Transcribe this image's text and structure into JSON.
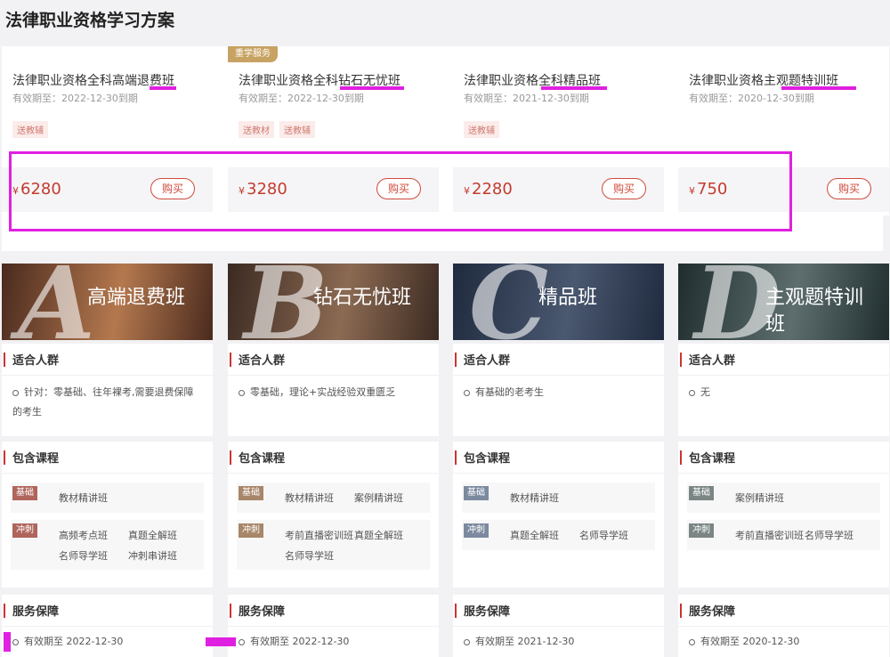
{
  "page_title": "法律职业资格学习方案",
  "plans": [
    {
      "badge": "",
      "name": "法律职业资格全科高端退费班",
      "expiry": "有效期至：2022-12-30到期",
      "tags": [
        "送教辅"
      ],
      "currency": "¥",
      "price": "6280",
      "buy": "购买"
    },
    {
      "badge": "重学服务",
      "name": "法律职业资格全科钻石无忧班",
      "expiry": "有效期至：2022-12-30到期",
      "tags": [
        "送教材",
        "送教辅"
      ],
      "currency": "¥",
      "price": "3280",
      "buy": "购买"
    },
    {
      "badge": "",
      "name": "法律职业资格全科精品班",
      "expiry": "有效期至：2021-12-30到期",
      "tags": [
        "送教辅"
      ],
      "currency": "¥",
      "price": "2280",
      "buy": "购买"
    },
    {
      "badge": "",
      "name": "法律职业资格主观题特训班",
      "expiry": "有效期至：2020-12-30到期",
      "tags": [],
      "currency": "¥",
      "price": "750",
      "buy": "购买"
    }
  ],
  "tiers": [
    {
      "letter": "A",
      "title": "高端退费班",
      "colors": [
        "#4a2a1e",
        "#b4784e"
      ],
      "audience_head": "适合人群",
      "audience": "针对：零基础、往年裸考,需要退费保障的考生",
      "courses_head": "包含课程",
      "groups": [
        {
          "level": "基础",
          "color": "#b0655c",
          "items": [
            "教材精讲班"
          ]
        },
        {
          "level": "冲刺",
          "color": "#b0655c",
          "items": [
            "高频考点班",
            "真题全解班",
            "名师导学班",
            "冲刺串讲班"
          ]
        }
      ],
      "service_head": "服务保障",
      "service": "有效期至 2022-12-30"
    },
    {
      "letter": "B",
      "title": "钻石无忧班",
      "colors": [
        "#3b2a22",
        "#8c6a52"
      ],
      "audience_head": "适合人群",
      "audience": "零基础，理论+实战经验双重匮乏",
      "courses_head": "包含课程",
      "groups": [
        {
          "level": "基础",
          "color": "#a8866a",
          "items": [
            "教材精讲班",
            "案例精讲班"
          ]
        },
        {
          "level": "冲刺",
          "color": "#a8866a",
          "items": [
            "考前直播密训班",
            "真题全解班",
            "名师导学班"
          ]
        }
      ],
      "service_head": "服务保障",
      "service": "有效期至 2022-12-30"
    },
    {
      "letter": "C",
      "title": "精品班",
      "colors": [
        "#1f2a3e",
        "#4a5870"
      ],
      "audience_head": "适合人群",
      "audience": "有基础的老考生",
      "courses_head": "包含课程",
      "groups": [
        {
          "level": "基础",
          "color": "#7c8aa0",
          "items": [
            "教材精讲班"
          ]
        },
        {
          "level": "冲刺",
          "color": "#7c8aa0",
          "items": [
            "真题全解班",
            "名师导学班"
          ]
        }
      ],
      "service_head": "服务保障",
      "service": "有效期至 2021-12-30"
    },
    {
      "letter": "D",
      "title": "主观题特训班",
      "colors": [
        "#1f2d2e",
        "#5e6e6e"
      ],
      "audience_head": "适合人群",
      "audience": "无",
      "courses_head": "包含课程",
      "groups": [
        {
          "level": "基础",
          "color": "#7a8584",
          "items": [
            "案例精讲班"
          ]
        },
        {
          "level": "冲刺",
          "color": "#7a8584",
          "items": [
            "考前直播密训班",
            "名师导学班"
          ]
        }
      ],
      "service_head": "服务保障",
      "service": "有效期至 2020-12-30"
    }
  ]
}
